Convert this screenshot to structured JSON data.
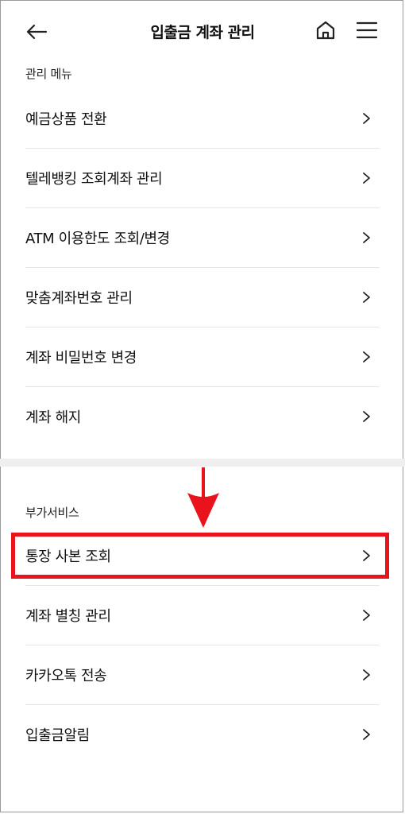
{
  "header": {
    "title": "입출금 계좌 관리",
    "back_icon": "arrow-left-icon",
    "home_icon": "home-icon",
    "menu_icon": "hamburger-menu-icon"
  },
  "sections": [
    {
      "label": "관리 메뉴",
      "items": [
        {
          "label": "예금상품 전환"
        },
        {
          "label": "텔레뱅킹 조회계좌 관리"
        },
        {
          "label": "ATM 이용한도 조회/변경"
        },
        {
          "label": "맞춤계좌번호 관리"
        },
        {
          "label": "계좌 비밀번호 변경"
        },
        {
          "label": "계좌 해지"
        }
      ]
    },
    {
      "label": "부가서비스",
      "items": [
        {
          "label": "통장 사본 조회"
        },
        {
          "label": "계좌 별칭 관리"
        },
        {
          "label": "카카오톡 전송"
        },
        {
          "label": "입출금알림"
        }
      ]
    }
  ],
  "annotation": {
    "highlight_color": "#e8131b",
    "highlighted_item": "통장 사본 조회"
  }
}
